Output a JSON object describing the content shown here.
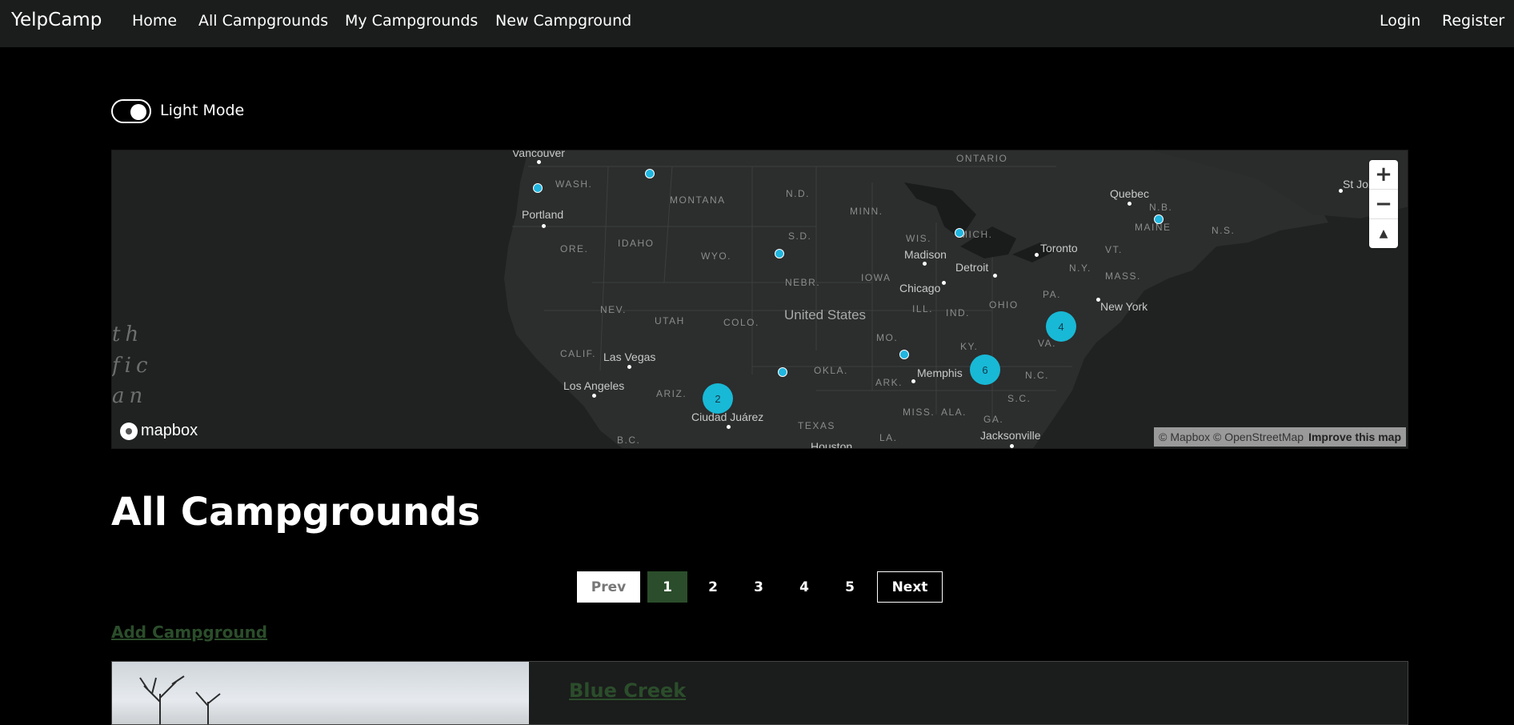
{
  "navbar": {
    "brand": "YelpCamp",
    "links": [
      "Home",
      "All Campgrounds",
      "My Campgrounds",
      "New Campground"
    ],
    "login": "Login",
    "register": "Register"
  },
  "theme_toggle": {
    "label": "Light Mode",
    "checked": true
  },
  "map": {
    "ocean_label": [
      "th",
      "fic",
      "an"
    ],
    "country_label": "United States",
    "cities": [
      "Vancouver",
      "Portland",
      "Las Vegas",
      "Los Angeles",
      "Ciudad Juárez",
      "Houston",
      "Memphis",
      "Chicago",
      "Madison",
      "Detroit",
      "Toronto",
      "Quebec",
      "St Joh",
      "New York",
      "Jacksonville"
    ],
    "states": [
      "WASH.",
      "MONTANA",
      "N.D.",
      "MINN.",
      "ONTARIO",
      "ORE.",
      "IDAHO",
      "S.D.",
      "WIS.",
      "MICH.",
      "WYO.",
      "NEBR.",
      "IOWA",
      "NEV.",
      "UTAH",
      "COLO.",
      "ILL.",
      "IND.",
      "OHIO",
      "PA.",
      "N.Y.",
      "VT.",
      "MASS.",
      "MAINE",
      "N.B.",
      "N.S.",
      "CALIF.",
      "MO.",
      "KY.",
      "VA.",
      "OKLA.",
      "ARK.",
      "N.C.",
      "ARIZ.",
      "TEXAS",
      "MISS.",
      "ALA.",
      "GA.",
      "S.C.",
      "LA.",
      "B.C."
    ],
    "clusters": [
      "2",
      "6",
      "4"
    ],
    "zoom_in": "+",
    "zoom_out": "−",
    "compass": "▲",
    "logo": "mapbox",
    "attribution": "© Mapbox © OpenStreetMap",
    "improve": "Improve this map"
  },
  "heading": "All Campgrounds",
  "pagination": {
    "prev": "Prev",
    "pages": [
      "1",
      "2",
      "3",
      "4",
      "5"
    ],
    "next": "Next",
    "current": "1"
  },
  "add_campground": "Add Campground",
  "campgrounds": [
    {
      "title": "Blue Creek"
    }
  ],
  "colors": {
    "accent_green": "#2b4d2b",
    "map_pin": "#20b6e0",
    "cluster": "#18b9d6"
  }
}
